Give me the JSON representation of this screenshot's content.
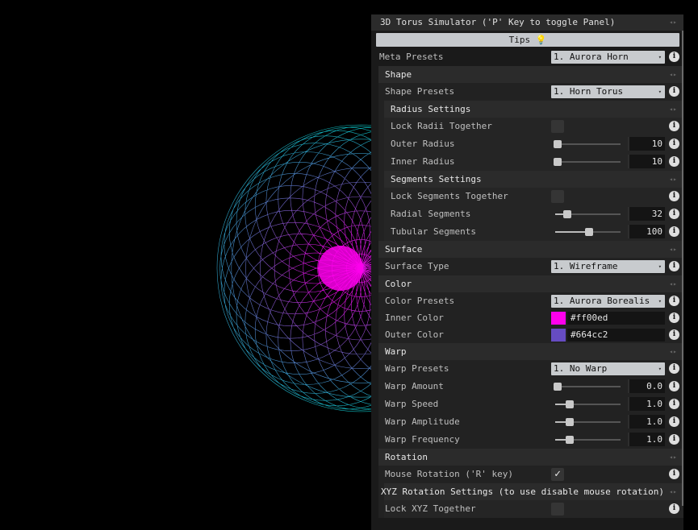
{
  "panel": {
    "title": "3D Torus Simulator ('P' Key to toggle Panel)",
    "tips_label": "Tips 💡",
    "meta_presets": {
      "label": "Meta Presets",
      "value": "1. Aurora Horn"
    },
    "shape": {
      "title": "Shape",
      "presets": {
        "label": "Shape Presets",
        "value": "1. Horn Torus"
      },
      "radius": {
        "title": "Radius Settings",
        "lock": {
          "label": "Lock Radii Together",
          "checked": false
        },
        "outer": {
          "label": "Outer Radius",
          "value": "10",
          "fraction": 0.0
        },
        "inner": {
          "label": "Inner Radius",
          "value": "10",
          "fraction": 0.0
        }
      },
      "segments": {
        "title": "Segments Settings",
        "lock": {
          "label": "Lock Segments Together",
          "checked": false
        },
        "radial": {
          "label": "Radial Segments",
          "value": "32",
          "fraction": 0.15
        },
        "tubular": {
          "label": "Tubular Segments",
          "value": "100",
          "fraction": 0.48
        }
      }
    },
    "surface": {
      "title": "Surface",
      "type": {
        "label": "Surface Type",
        "value": "1. Wireframe"
      }
    },
    "color": {
      "title": "Color",
      "presets": {
        "label": "Color Presets",
        "value": "1. Aurora Borealis"
      },
      "inner": {
        "label": "Inner Color",
        "value": "#ff00ed",
        "swatch": "#ff00ed"
      },
      "outer": {
        "label": "Outer Color",
        "value": "#664cc2",
        "swatch": "#664cc2"
      }
    },
    "warp": {
      "title": "Warp",
      "presets": {
        "label": "Warp Presets",
        "value": "1. No Warp"
      },
      "amount": {
        "label": "Warp Amount",
        "value": "0.0",
        "fraction": 0.0
      },
      "speed": {
        "label": "Warp Speed",
        "value": "1.0",
        "fraction": 0.18
      },
      "amplitude": {
        "label": "Warp Amplitude",
        "value": "1.0",
        "fraction": 0.18
      },
      "frequency": {
        "label": "Warp Frequency",
        "value": "1.0",
        "fraction": 0.18
      }
    },
    "rotation": {
      "title": "Rotation",
      "mouse": {
        "label": "Mouse Rotation ('R' key)",
        "checked": true
      },
      "xyz": {
        "title": "XYZ Rotation Settings (to use disable mouse rotation)",
        "lock": {
          "label": "Lock XYZ Together",
          "checked": false
        }
      }
    }
  },
  "icons": {
    "info": "i",
    "collapse": "◂▸",
    "dropdown": "▾",
    "check": "✓"
  },
  "colors": {
    "background": "#000000",
    "panel": "#1a1a1a",
    "torus_inner": "#ff00ed",
    "torus_outer": "#00c8c8"
  }
}
